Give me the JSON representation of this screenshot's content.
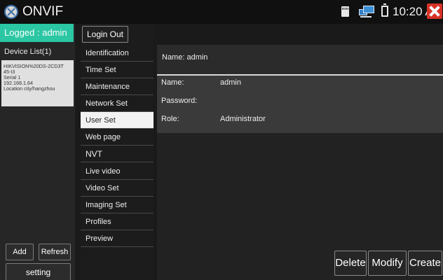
{
  "status_bar": {
    "app_title": "ONVIF",
    "time": "10:20 AM"
  },
  "left_panel": {
    "logged_label": "Logged : admin",
    "device_list_title": "Device List(1)",
    "device": {
      "line1": "HIKVISION%20DS-2CD3T",
      "line2": "45-I3",
      "line3": "Serial  1",
      "line4": "192.168.1.64",
      "line5": "Location city/hangzhou"
    },
    "add_label": "Add",
    "refresh_label": "Refresh",
    "setting_label": "setting"
  },
  "menu": {
    "login_out_label": "Login Out",
    "items": [
      "Identification",
      "Time Set",
      "Maintenance",
      "Network Set",
      "User Set",
      "Web page",
      "NVT",
      "Live video",
      "Video Set",
      "Imaging Set",
      "Profiles",
      "Preview"
    ],
    "active_item": "User Set"
  },
  "content": {
    "header_name": "Name: admin",
    "fields": {
      "name_label": "Name:",
      "name_value": "admin",
      "password_label": "Password:",
      "password_value": "",
      "role_label": "Role:",
      "role_value": "Administrator"
    },
    "buttons": {
      "delete": "Delete",
      "modify": "Modify",
      "create": "Create"
    }
  }
}
